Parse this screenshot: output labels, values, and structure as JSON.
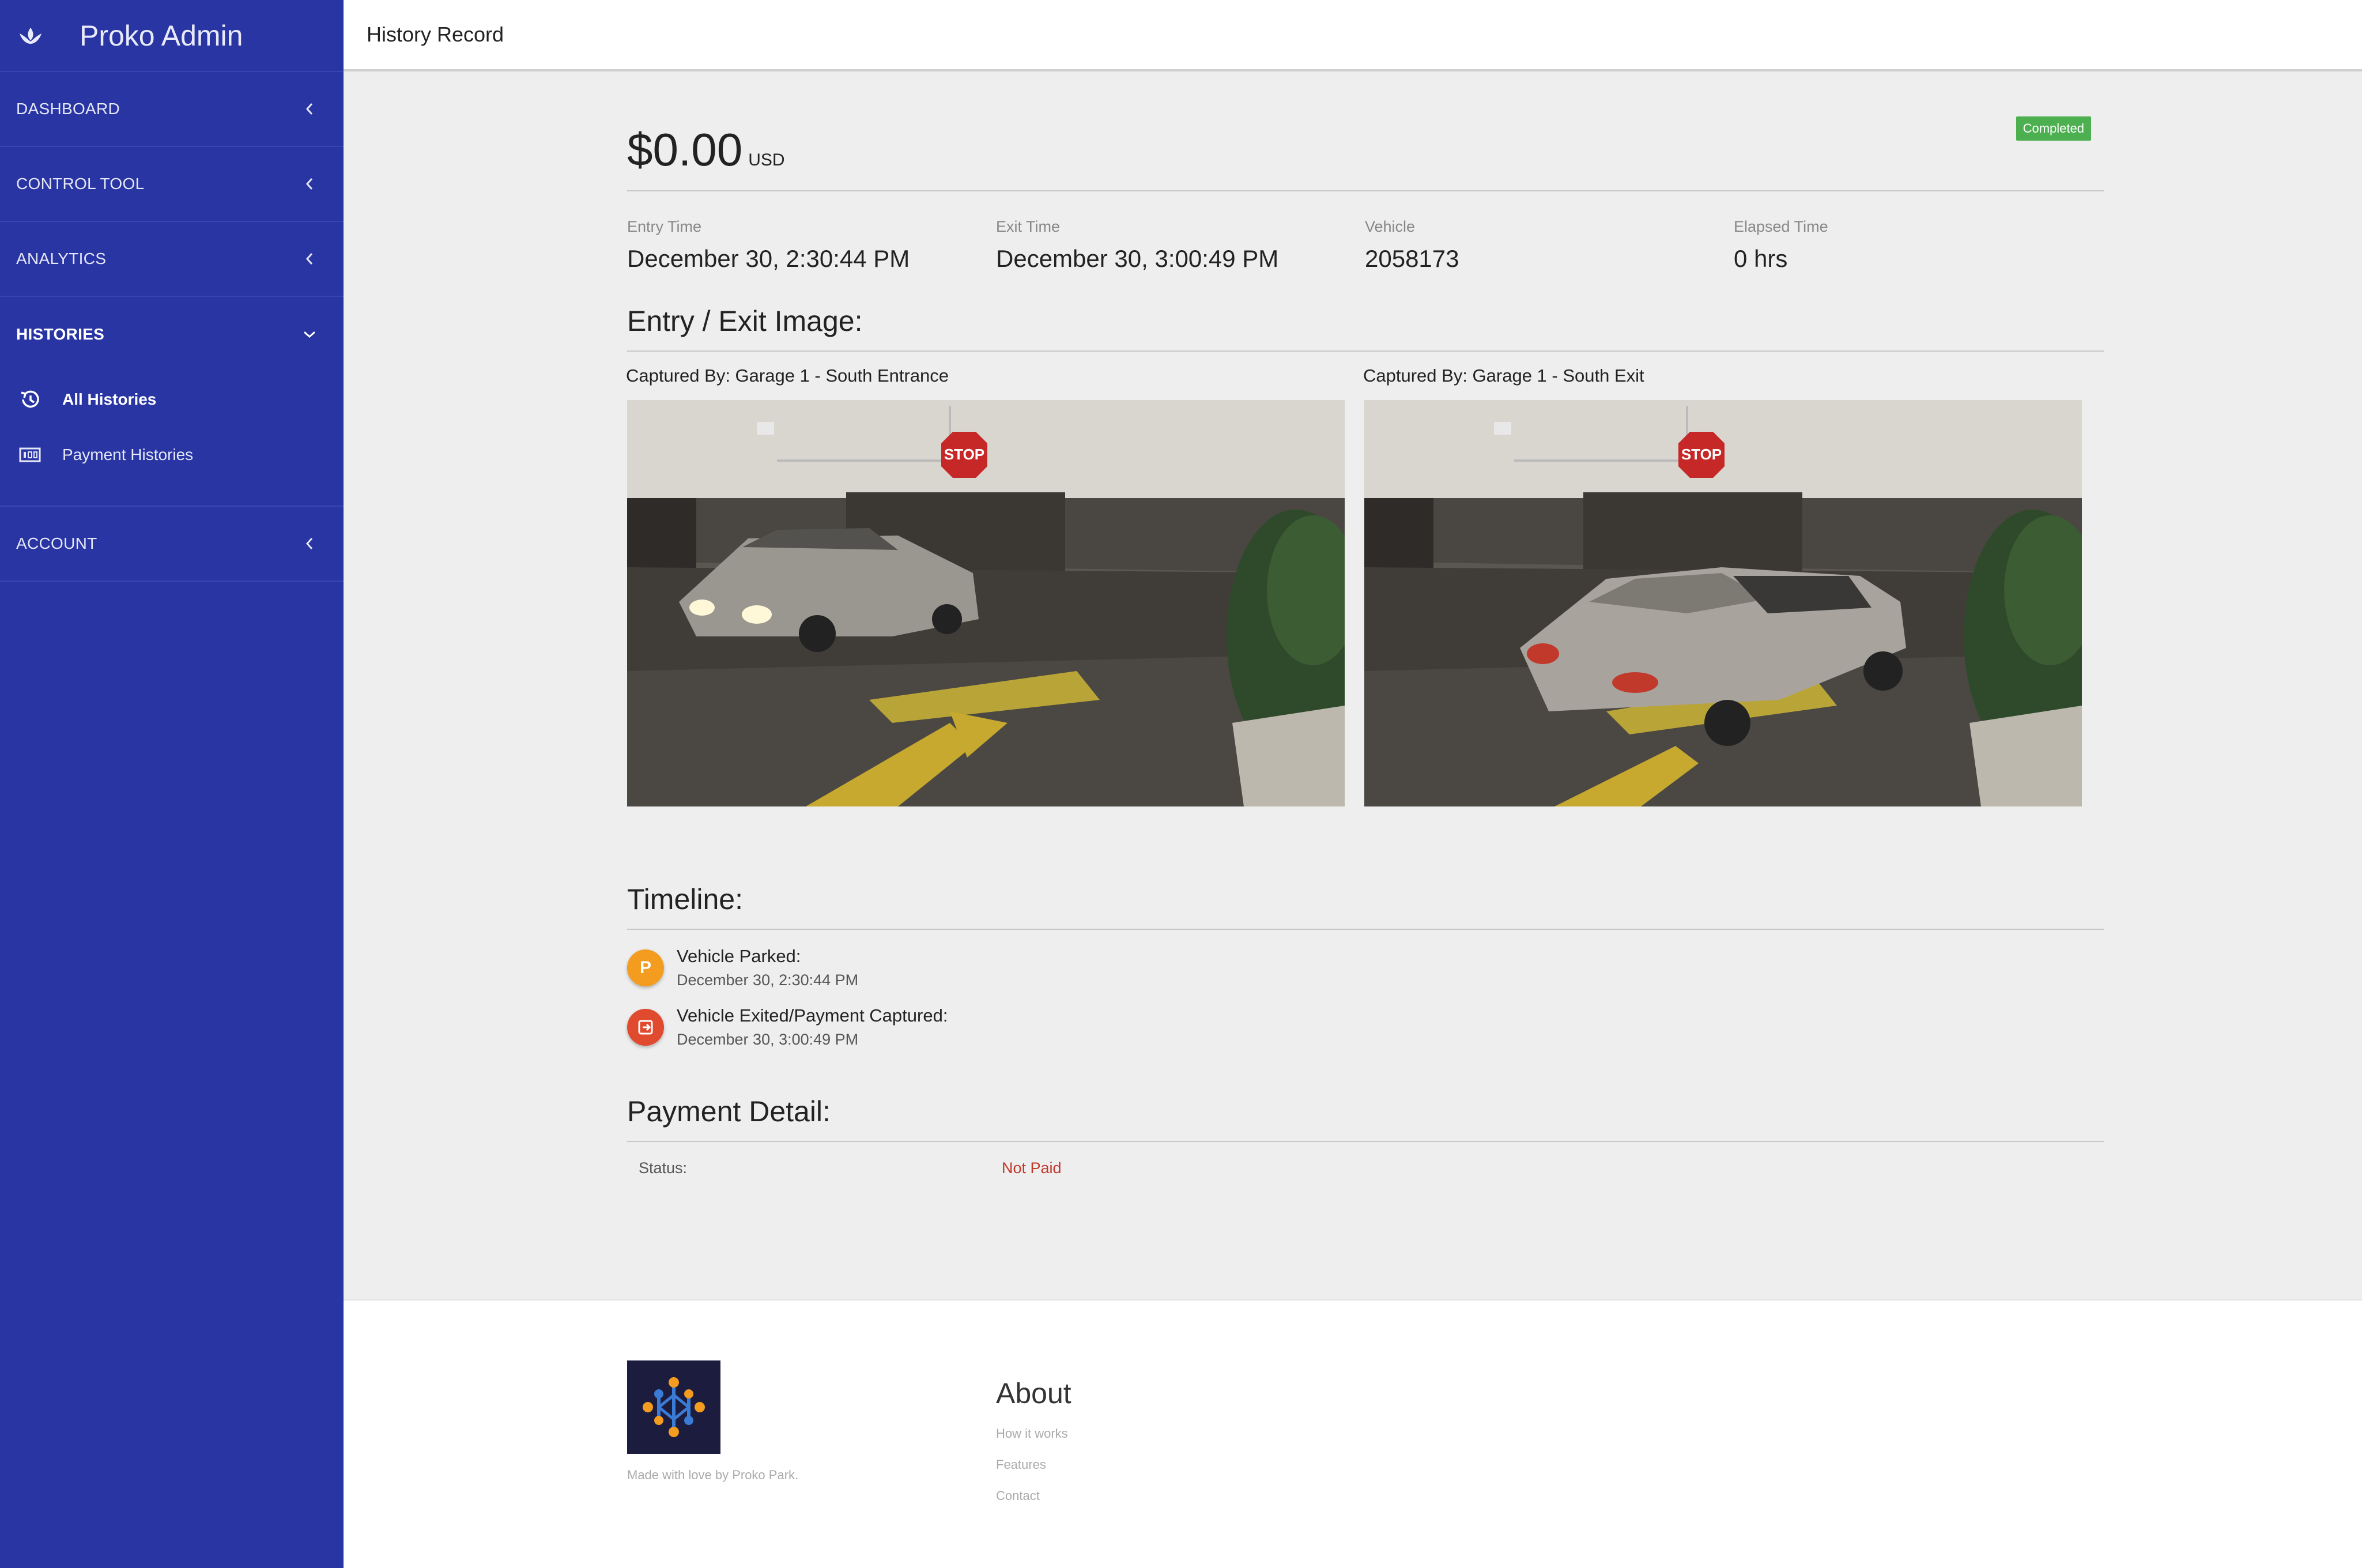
{
  "sidebar": {
    "brand": "Proko Admin",
    "items": [
      {
        "label": "DASHBOARD"
      },
      {
        "label": "CONTROL TOOL"
      },
      {
        "label": "ANALYTICS"
      },
      {
        "label": "HISTORIES"
      },
      {
        "label": "ACCOUNT"
      }
    ],
    "subitems": [
      {
        "label": "All Histories"
      },
      {
        "label": "Payment Histories"
      }
    ]
  },
  "header": {
    "title": "History Record"
  },
  "record": {
    "amount": "$0.00",
    "currency": "USD",
    "status_badge": "Completed",
    "stats": [
      {
        "label": "Entry Time",
        "value": "December 30, 2:30:44 PM"
      },
      {
        "label": "Exit Time",
        "value": "December 30, 3:00:49 PM"
      },
      {
        "label": "Vehicle",
        "value": "2058173"
      },
      {
        "label": "Elapsed Time",
        "value": "0 hrs"
      }
    ]
  },
  "images": {
    "title": "Entry / Exit Image:",
    "entry_caption": "Captured By: Garage 1 - South Entrance",
    "exit_caption": "Captured By: Garage 1 - South Exit",
    "stop_sign_text": "STOP"
  },
  "timeline": {
    "title": "Timeline:",
    "events": [
      {
        "icon_text": "P",
        "title": "Vehicle Parked:",
        "date": "December 30, 2:30:44 PM"
      },
      {
        "title": "Vehicle Exited/Payment Captured:",
        "date": "December 30, 3:00:49 PM"
      }
    ]
  },
  "payment": {
    "title": "Payment Detail:",
    "status_label": "Status:",
    "status_value": "Not Paid"
  },
  "footer": {
    "made_with": "Made with love by Proko Park.",
    "about_title": "About",
    "links": [
      "How it works",
      "Features",
      "Contact"
    ]
  },
  "colors": {
    "sidebar": "#2935a3",
    "badge": "#4caf50",
    "parked_dot": "#f39c1f",
    "exit_dot": "#e04a2f",
    "not_paid": "#c0392b"
  }
}
